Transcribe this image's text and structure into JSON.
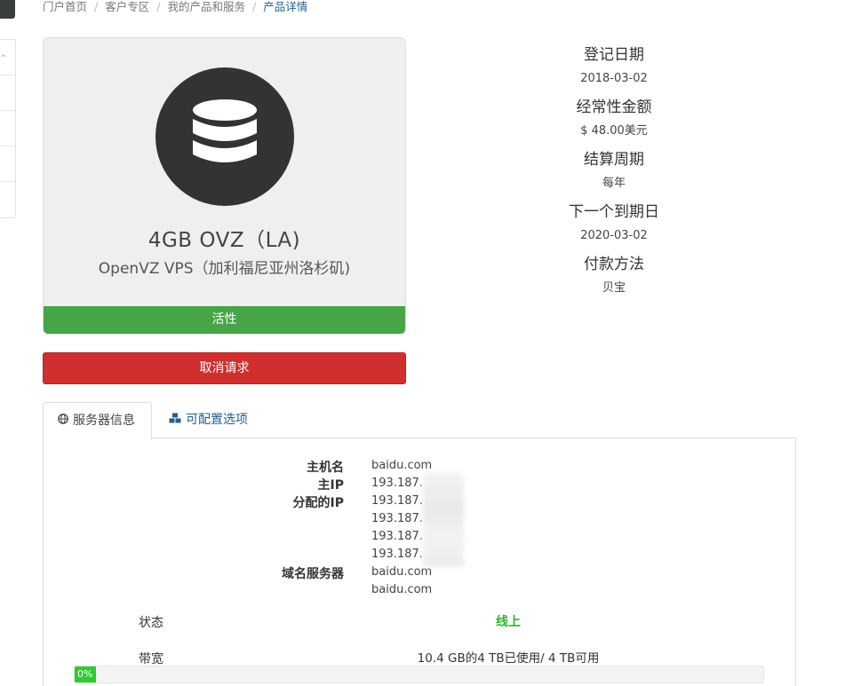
{
  "breadcrumb": [
    "门户首页",
    "客户专区",
    "我的产品和服务",
    "产品详情"
  ],
  "product": {
    "icon": "database-icon",
    "title": "4GB OVZ（LA)",
    "subtitle": "OpenVZ VPS（加利福尼亚州洛杉矶)",
    "status": "活性",
    "status_color": "#46a546"
  },
  "actions": {
    "cancel_label": "取消请求",
    "cancel_color": "#d02f2f"
  },
  "details": [
    {
      "label": "登记日期",
      "value": "2018-03-02"
    },
    {
      "label": "经常性金额",
      "value": "$ 48.00美元"
    },
    {
      "label": "结算周期",
      "value": "每年"
    },
    {
      "label": "下一个到期日",
      "value": "2020-03-02"
    },
    {
      "label": "付款方法",
      "value": "贝宝"
    }
  ],
  "tabs": [
    {
      "label": "服务器信息",
      "icon": "globe-icon"
    },
    {
      "label": "可配置选项",
      "icon": "cubes-icon"
    }
  ],
  "server_info": {
    "hostname_label": "主机名",
    "hostname": "baidu.com",
    "main_ip_label": "主IP",
    "main_ip": "193.187.",
    "assigned_ip_label": "分配的IP",
    "assigned_ips": [
      "193.187.",
      "193.187.",
      "193.187.",
      "193.187."
    ],
    "nameservers_label": "域名服务器",
    "nameservers": [
      "baidu.com",
      "baidu.com"
    ]
  },
  "status_row": {
    "label": "状态",
    "value": "线上",
    "color": "#2fb52f"
  },
  "bandwidth": {
    "label": "带宽",
    "text": "10.4 GB的4 TB已使用/ 4 TB可用",
    "percent": 0,
    "percent_label": "0%"
  }
}
